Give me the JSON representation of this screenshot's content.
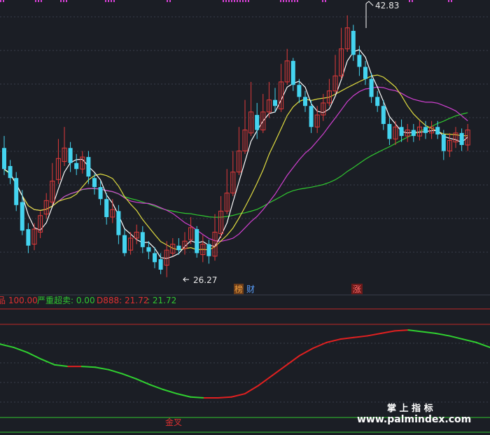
{
  "chart_data": [
    {
      "type": "candlestick",
      "panel": "price",
      "max_price_label": "42.83",
      "min_price_label": "26.27",
      "annotations": [
        "榜",
        "财",
        "涨"
      ],
      "colors": {
        "up": "#e13a3a",
        "down": "#44d4f0",
        "ma_fast": "#ffffff",
        "ma_mid": "#e0dc40",
        "ma_slow": "#d040d0",
        "ma_long": "#30c830",
        "grid": "#3a3f4b"
      },
      "candles": [
        [
          34.0,
          32.6,
          34.8,
          32.2
        ],
        [
          32.8,
          32.0,
          33.2,
          31.6
        ],
        [
          32.0,
          30.2,
          32.4,
          29.8
        ],
        [
          30.4,
          28.5,
          31.2,
          28.2
        ],
        [
          28.6,
          27.5,
          29.0,
          27.0
        ],
        [
          27.6,
          28.6,
          29.0,
          27.2
        ],
        [
          28.4,
          29.5,
          29.8,
          28.0
        ],
        [
          29.6,
          30.5,
          31.0,
          29.3
        ],
        [
          30.4,
          31.8,
          33.0,
          30.2
        ],
        [
          31.9,
          33.3,
          34.6,
          31.6
        ],
        [
          33.1,
          34.0,
          35.4,
          32.8
        ],
        [
          34.0,
          33.0,
          34.4,
          32.4
        ],
        [
          33.0,
          32.6,
          33.6,
          32.2
        ],
        [
          32.6,
          33.4,
          33.8,
          32.3
        ],
        [
          33.4,
          32.1,
          33.8,
          31.6
        ],
        [
          32.0,
          31.4,
          32.3,
          30.9
        ],
        [
          31.4,
          30.6,
          31.8,
          30.2
        ],
        [
          30.6,
          29.4,
          31.0,
          28.9
        ],
        [
          29.4,
          29.9,
          30.6,
          29.0
        ],
        [
          29.8,
          28.2,
          30.2,
          27.6
        ],
        [
          28.2,
          27.0,
          28.6,
          26.8
        ],
        [
          27.2,
          28.0,
          28.4,
          26.9
        ],
        [
          28.0,
          28.4,
          28.9,
          27.6
        ],
        [
          28.4,
          27.4,
          28.8,
          27.0
        ],
        [
          27.4,
          27.1,
          27.8,
          26.6
        ],
        [
          27.0,
          26.4,
          27.4,
          26.0
        ],
        [
          26.6,
          25.9,
          27.0,
          25.6
        ],
        [
          26.2,
          27.2,
          27.8,
          25.4
        ],
        [
          27.0,
          27.6,
          28.0,
          26.8
        ],
        [
          27.5,
          27.2,
          28.0,
          26.9
        ],
        [
          27.3,
          27.8,
          28.4,
          26.9
        ],
        [
          27.9,
          28.7,
          29.4,
          27.6
        ],
        [
          28.6,
          27.0,
          28.8,
          26.7
        ],
        [
          26.9,
          27.6,
          28.2,
          26.4
        ],
        [
          27.6,
          26.8,
          27.9,
          26.3
        ],
        [
          26.8,
          28.4,
          29.6,
          26.5
        ],
        [
          28.3,
          29.8,
          30.8,
          28.0
        ],
        [
          29.8,
          31.0,
          32.6,
          29.6
        ],
        [
          31.0,
          32.4,
          33.8,
          30.8
        ],
        [
          32.4,
          33.8,
          35.4,
          32.2
        ],
        [
          33.8,
          35.2,
          37.2,
          33.6
        ],
        [
          35.0,
          36.4,
          38.4,
          34.8
        ],
        [
          36.2,
          35.2,
          37.0,
          34.6
        ],
        [
          35.2,
          36.4,
          37.6,
          35.0
        ],
        [
          36.4,
          37.2,
          38.4,
          36.0
        ],
        [
          37.2,
          36.8,
          38.0,
          36.4
        ],
        [
          36.6,
          38.4,
          39.6,
          36.4
        ],
        [
          38.4,
          39.8,
          40.6,
          38.2
        ],
        [
          39.8,
          38.2,
          40.0,
          37.8
        ],
        [
          38.2,
          37.4,
          38.6,
          37.0
        ],
        [
          37.4,
          36.8,
          37.8,
          36.4
        ],
        [
          36.8,
          35.4,
          37.2,
          35.0
        ],
        [
          35.4,
          36.2,
          36.8,
          35.0
        ],
        [
          36.2,
          37.0,
          37.6,
          35.8
        ],
        [
          37.0,
          37.8,
          38.6,
          36.8
        ],
        [
          37.8,
          38.8,
          40.2,
          37.6
        ],
        [
          38.8,
          40.6,
          42.0,
          38.6
        ],
        [
          40.6,
          42.0,
          42.83,
          40.4
        ],
        [
          41.8,
          40.2,
          42.2,
          39.8
        ],
        [
          40.2,
          39.4,
          40.8,
          38.8
        ],
        [
          39.4,
          38.6,
          39.8,
          38.2
        ],
        [
          38.6,
          37.4,
          39.0,
          37.0
        ],
        [
          37.4,
          36.8,
          37.8,
          36.4
        ],
        [
          36.8,
          35.6,
          37.2,
          35.2
        ],
        [
          35.6,
          34.6,
          36.0,
          34.2
        ],
        [
          34.6,
          35.4,
          35.8,
          34.2
        ],
        [
          35.4,
          34.8,
          35.9,
          34.4
        ],
        [
          34.8,
          35.2,
          35.6,
          34.4
        ],
        [
          35.2,
          34.8,
          35.6,
          34.4
        ],
        [
          34.8,
          35.4,
          35.8,
          34.5
        ],
        [
          35.4,
          35.0,
          35.8,
          34.6
        ],
        [
          35.0,
          35.4,
          35.8,
          34.6
        ],
        [
          35.4,
          34.9,
          35.8,
          34.6
        ],
        [
          34.9,
          33.8,
          35.2,
          33.2
        ],
        [
          33.8,
          34.5,
          35.0,
          33.4
        ],
        [
          34.4,
          35.0,
          35.4,
          34.0
        ],
        [
          35.0,
          34.2,
          35.3,
          33.8
        ],
        [
          34.2,
          35.2,
          35.6,
          33.8
        ]
      ]
    },
    {
      "type": "line",
      "panel": "indicator",
      "legend": [
        {
          "label": "品 100.00",
          "color": "#e03030"
        },
        {
          "label": "严重超卖: 0.00",
          "color": "#30c830"
        },
        {
          "label": "D888: 21.72",
          "color": "#e03030"
        },
        {
          "label": ": 21.72",
          "color": "#30c830"
        }
      ],
      "annotation": "金叉",
      "watermark_cn": "掌 上 指 标",
      "watermark_url": "www.palmindex.com",
      "series": [
        {
          "name": "D888",
          "values": [
            82,
            78,
            72,
            64,
            57,
            55,
            55,
            54,
            51,
            46,
            40,
            33,
            27,
            22,
            18,
            17,
            17,
            18,
            22,
            32,
            44,
            56,
            68,
            77,
            84,
            88,
            90,
            92,
            95,
            98,
            99,
            97,
            95,
            92,
            88,
            84,
            78
          ]
        }
      ]
    }
  ]
}
